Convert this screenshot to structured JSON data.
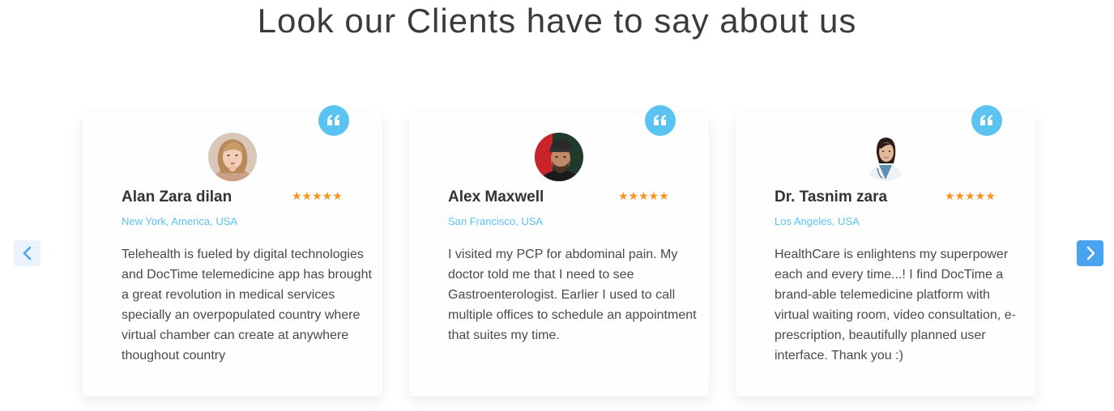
{
  "header": {
    "title": "Look our Clients have to say about us"
  },
  "testimonials": [
    {
      "name": "Alan Zara dilan",
      "location": "New York, America, USA",
      "rating": 5,
      "stars": "★★★★★",
      "text": "Telehealth is fueled by digital technologies and DocTime telemedicine app has brought a great revolution in medical services specially an overpopulated country where virtual chamber can create at anywhere thoughout country"
    },
    {
      "name": "Alex Maxwell",
      "location": "San Francisco, USA",
      "rating": 5,
      "stars": "★★★★★",
      "text": "I visited my PCP for abdominal pain. My doctor told me that I need to see Gastroenterologist. Earlier I used to call multiple offices to schedule an appointment that suites my time."
    },
    {
      "name": "Dr. Tasnim zara",
      "location": "Los Angeles, USA",
      "rating": 5,
      "stars": "★★★★★",
      "text": "HealthCare is enlightens my superpower each and every time...! I find DocTime a brand-able telemedicine platform with virtual waiting room, video consultation, e-prescription, beautifully planned user interface. Thank you   :)"
    }
  ],
  "carousel": {
    "prev_icon": "chevron-left-icon",
    "next_icon": "chevron-right-icon"
  },
  "colors": {
    "accent": "#5bc3f2",
    "star": "#f8931d",
    "next_button": "#4aa3ef",
    "prev_button": "#eaf3fb"
  }
}
